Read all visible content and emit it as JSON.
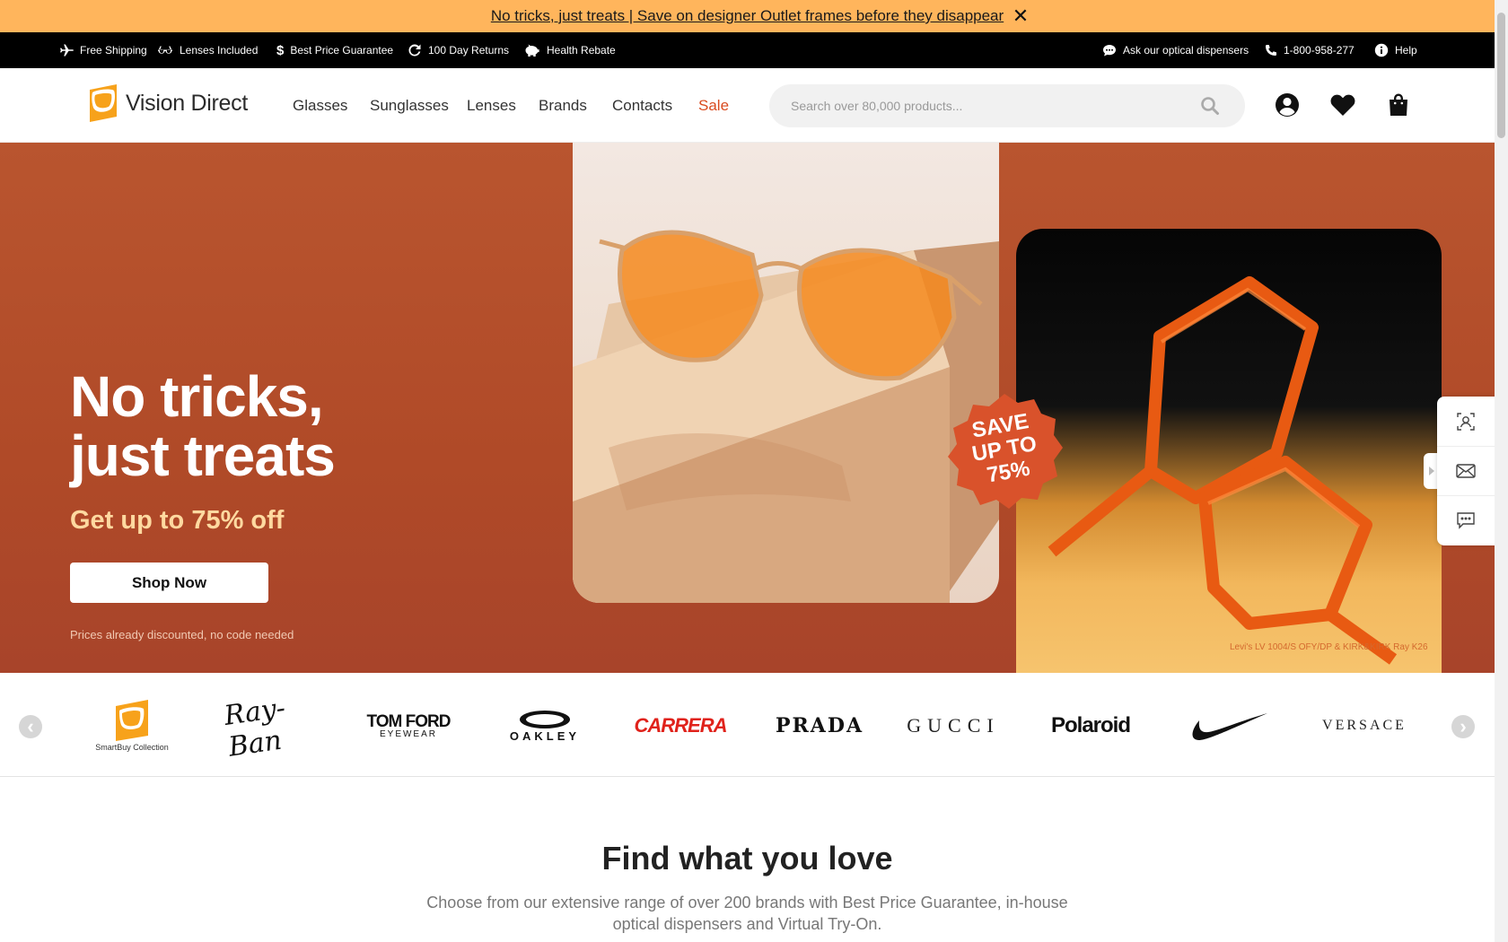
{
  "promo": {
    "link_text": "No tricks, just treats | Save on designer Outlet frames before they disappear",
    "close_glyph": "✕"
  },
  "utility_bar": {
    "left": [
      {
        "icon": "plane-icon",
        "label": "Free Shipping"
      },
      {
        "icon": "glasses-icon",
        "label": "Lenses Included"
      },
      {
        "icon": "dollar-icon",
        "label": "Best Price Guarantee"
      },
      {
        "icon": "return-icon",
        "label": "100 Day Returns"
      },
      {
        "icon": "piggy-bank-icon",
        "label": "Health Rebate"
      }
    ],
    "right": [
      {
        "icon": "chat-bubble-icon",
        "label": "Ask our optical dispensers"
      },
      {
        "icon": "phone-icon",
        "label": "1-800-958-277"
      },
      {
        "icon": "info-icon",
        "label": "Help"
      }
    ]
  },
  "header": {
    "logo_text": "Vision Direct",
    "nav": [
      "Glasses",
      "Sunglasses",
      "Lenses",
      "Brands",
      "Contacts",
      "Sale"
    ],
    "sale_color": "#d94b1f",
    "search_placeholder": "Search over 80,000 products..."
  },
  "hero": {
    "title_line1": "No tricks,",
    "title_line2": "just treats",
    "subtitle": "Get up to 75% off",
    "cta": "Shop Now",
    "note": "Prices already discounted, no code needed",
    "badge": [
      "SAVE",
      "UP TO",
      "75%"
    ],
    "credit": "Levi's LV 1004/S OFY/DP & KIRK&KIRK Ray K26",
    "bg_color": "#b4512f"
  },
  "brands": {
    "items": [
      "SmartBuy Collection",
      "Ray-Ban",
      "TOM FORD",
      "EYEWEAR",
      "OAKLEY",
      "CARRERA",
      "PRADA",
      "GUCCI",
      "Polaroid",
      "Nike",
      "VERSACE"
    ],
    "prev_glyph": "‹",
    "next_glyph": "›"
  },
  "section": {
    "title": "Find what you love",
    "body": "Choose from our extensive range of over 200 brands with Best Price Guarantee, in-house optical dispensers and Virtual Try-On."
  },
  "side_widget": {
    "buttons": [
      "virtual-try-on-icon",
      "mail-icon",
      "chat-icon"
    ]
  }
}
